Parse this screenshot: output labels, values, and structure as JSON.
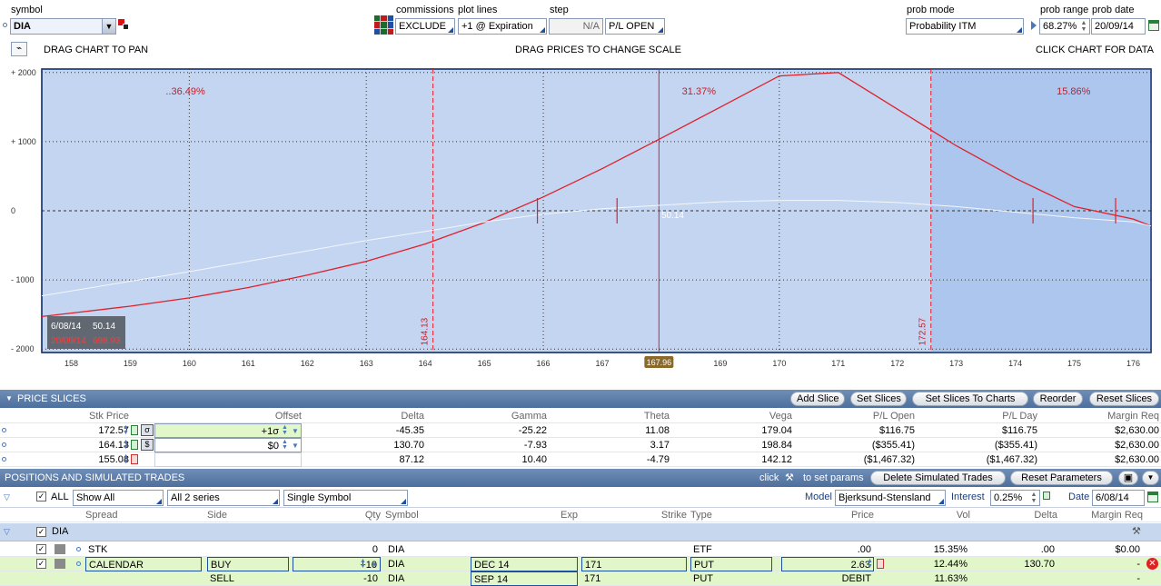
{
  "top": {
    "symbol_label": "symbol",
    "symbol_value": "DIA",
    "commissions_label": "commissions",
    "commissions_value": "EXCLUDE",
    "plot_lines_label": "plot lines",
    "plot_lines_value": "+1 @ Expiration",
    "step_label": "step",
    "step_value": "N/A",
    "pl_mode_value": "P/L OPEN",
    "prob_mode_label": "prob mode",
    "prob_mode_value": "Probability ITM",
    "prob_range_label": "prob range",
    "prob_range_value": "68.27%",
    "prob_date_label": "prob date",
    "prob_date_value": "20/09/14"
  },
  "hints": {
    "pan": "DRAG CHART TO PAN",
    "scale": "DRAG PRICES TO CHANGE SCALE",
    "click": "CLICK CHART FOR DATA"
  },
  "chart_data": {
    "type": "line",
    "xlim": [
      157.5,
      176.3
    ],
    "ylim": [
      -2050,
      2050
    ],
    "x_ticks": [
      "158",
      "159",
      "160",
      "161",
      "162",
      "163",
      "164",
      "165",
      "166",
      "167",
      "168",
      "169",
      "170",
      "171",
      "172",
      "173",
      "174",
      "175",
      "176"
    ],
    "y_ticks": [
      "+ 2000",
      "+ 1000",
      "0",
      "- 1000",
      "- 2000"
    ],
    "series": [
      {
        "color": "#e0202a",
        "x": [
          157.5,
          158,
          159,
          160,
          161,
          162,
          163,
          164,
          165,
          166,
          167,
          168,
          169,
          170,
          171,
          172,
          173,
          174,
          175,
          176,
          176.3
        ],
        "y": [
          -1530,
          -1480,
          -1380,
          -1260,
          -1110,
          -930,
          -730,
          -480,
          -170,
          200,
          610,
          1050,
          1500,
          1950,
          2000,
          1470,
          940,
          470,
          60,
          -120,
          -220
        ]
      },
      {
        "color": "#f4f6fa",
        "x": [
          157.5,
          158,
          159,
          160,
          161,
          162,
          163,
          164,
          165,
          166,
          167,
          168,
          169,
          170,
          171,
          172,
          173,
          174,
          175,
          176,
          176.3
        ],
        "y": [
          -1230,
          -1160,
          -1020,
          -880,
          -730,
          -580,
          -430,
          -300,
          -160,
          -50,
          30,
          80,
          130,
          150,
          150,
          120,
          60,
          -20,
          -100,
          -160,
          -220
        ]
      }
    ],
    "prob_labels": [
      "..36.49%",
      "31.37%",
      "15.86%"
    ],
    "slice_labels": [
      "164.13",
      "172.57"
    ],
    "current_price": "167.96",
    "curve_label": "50.14",
    "tooltip": {
      "date1": "6/08/14",
      "val1": "50.14",
      "date2": "20/09/14",
      "val2": "698.93"
    }
  },
  "price_slices": {
    "title": "PRICE SLICES",
    "buttons": [
      "Add Slice",
      "Set Slices",
      "Set Slices To Charts",
      "Reorder",
      "Reset Slices"
    ],
    "headers": [
      "Stk Price",
      "Offset",
      "Delta",
      "Gamma",
      "Theta",
      "Vega",
      "P/L Open",
      "P/L Day",
      "Margin Req"
    ],
    "rows": [
      {
        "stk": "172.57",
        "offset": "+1σ",
        "delta": "-45.35",
        "gamma": "-25.22",
        "theta": "11.08",
        "vega": "179.04",
        "plopen": "$116.75",
        "plday": "$116.75",
        "margin": "$2,630.00"
      },
      {
        "stk": "164.13",
        "offset": "$0",
        "delta": "130.70",
        "gamma": "-7.93",
        "theta": "3.17",
        "vega": "198.84",
        "plopen": "($355.41)",
        "plday": "($355.41)",
        "margin": "$2,630.00"
      },
      {
        "stk": "155.08",
        "offset": "",
        "delta": "87.12",
        "gamma": "10.40",
        "theta": "-4.79",
        "vega": "142.12",
        "plopen": "($1,467.32)",
        "plday": "($1,467.32)",
        "margin": "$2,630.00"
      }
    ]
  },
  "positions": {
    "title": "POSITIONS AND SIMULATED TRADES",
    "click_text": "click",
    "params_text": "to set params",
    "delete_btn": "Delete Simulated Trades",
    "reset_btn": "Reset Parameters",
    "filter_all": "ALL",
    "filter_show": "Show All",
    "filter_series": "All 2 series",
    "filter_symbol": "Single Symbol",
    "model_label": "Model",
    "model_value": "Bjerksund-Stensland",
    "interest_label": "Interest",
    "interest_value": "0.25%",
    "date_label": "Date",
    "date_value": "6/08/14",
    "headers": [
      "Spread",
      "Side",
      "Qty",
      "Symbol",
      "Exp",
      "Strike",
      "Type",
      "Price",
      "Vol",
      "Delta",
      "Margin Req"
    ],
    "group": "DIA",
    "rows": [
      {
        "spread": "STK",
        "side": "",
        "qty": "0",
        "symbol": "DIA",
        "exp": "",
        "strike": "",
        "type": "ETF",
        "price": ".00",
        "vol": "15.35%",
        "delta": ".00",
        "margin": "$0.00"
      },
      {
        "spread": "CALENDAR",
        "side": "BUY",
        "qty": "+10",
        "symbol": "DIA",
        "exp": "DEC 14",
        "strike": "171",
        "type": "PUT",
        "price": "2.63",
        "vol": "12.44%",
        "delta": "130.70",
        "margin": "-"
      },
      {
        "spread": "",
        "side": "SELL",
        "qty": "-10",
        "symbol": "DIA",
        "exp": "SEP 14",
        "strike": "171",
        "type": "PUT",
        "price": "DEBIT",
        "vol": "11.63%",
        "delta": "",
        "margin": "-"
      }
    ]
  }
}
